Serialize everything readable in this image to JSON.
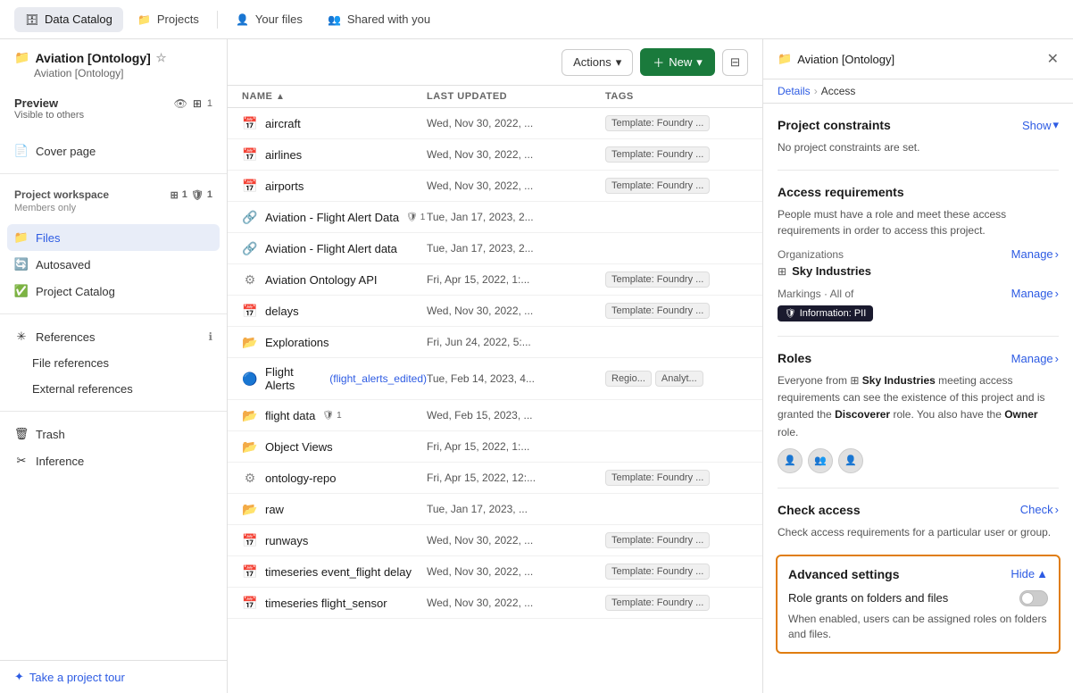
{
  "nav": {
    "tabs": [
      {
        "id": "data-catalog",
        "label": "Data Catalog",
        "icon": "🗄",
        "active": true
      },
      {
        "id": "projects",
        "label": "Projects",
        "icon": "📁",
        "active": false
      },
      {
        "id": "your-files",
        "label": "Your files",
        "icon": "👤",
        "active": false
      },
      {
        "id": "shared-with-you",
        "label": "Shared with you",
        "icon": "👥",
        "active": false
      }
    ]
  },
  "sidebar": {
    "project_title": "Aviation [Ontology]",
    "project_subtitle": "Aviation [Ontology]",
    "preview": {
      "title": "Preview",
      "subtitle": "Visible to others"
    },
    "cover_page": "Cover page",
    "project_workspace": {
      "title": "Project workspace",
      "subtitle": "Members only",
      "count1": "1",
      "count2": "1"
    },
    "files_label": "Files",
    "autosaved_label": "Autosaved",
    "project_catalog_label": "Project Catalog",
    "references_label": "References",
    "file_references_label": "File references",
    "external_references_label": "External references",
    "trash_label": "Trash",
    "inference_label": "Inference",
    "take_tour": "Take a project tour"
  },
  "toolbar": {
    "actions_label": "Actions",
    "new_label": "New",
    "actions_chevron": "▾",
    "new_chevron": "▾"
  },
  "file_table": {
    "columns": [
      "NAME",
      "LAST UPDATED",
      "TAGS"
    ],
    "rows": [
      {
        "name": "aircraft",
        "icon": "📅",
        "updated": "Wed, Nov 30, 2022, ...",
        "tags": [
          "Template: Foundry ..."
        ]
      },
      {
        "name": "airlines",
        "icon": "📅",
        "updated": "Wed, Nov 30, 2022, ...",
        "tags": [
          "Template: Foundry ..."
        ]
      },
      {
        "name": "airports",
        "icon": "📅",
        "updated": "Wed, Nov 30, 2022, ...",
        "tags": [
          "Template: Foundry ..."
        ]
      },
      {
        "name": "Aviation - Flight Alert Data",
        "icon": "🔗",
        "updated": "Tue, Jan 17, 2023, 2...",
        "tags": [],
        "locked": true
      },
      {
        "name": "Aviation - Flight Alert data",
        "icon": "🔗",
        "updated": "Tue, Jan 17, 2023, 2...",
        "tags": []
      },
      {
        "name": "Aviation Ontology API",
        "icon": "⚙",
        "updated": "Fri, Apr 15, 2022, 1:...",
        "tags": [
          "Template: Foundry ..."
        ]
      },
      {
        "name": "delays",
        "icon": "📅",
        "updated": "Wed, Nov 30, 2022, ...",
        "tags": [
          "Template: Foundry ..."
        ]
      },
      {
        "name": "Explorations",
        "icon": "📂",
        "updated": "Fri, Jun 24, 2022, 5:...",
        "tags": [],
        "folder_yellow": true
      },
      {
        "name": "Flight Alerts",
        "nameExtra": "(flight_alerts_edited)",
        "icon": "🔵",
        "updated": "Tue, Feb 14, 2023, 4...",
        "tags": [
          "Regio...",
          "Analyt..."
        ],
        "is_link": true
      },
      {
        "name": "flight data",
        "icon": "📂",
        "updated": "Wed, Feb 15, 2023, ...",
        "tags": [],
        "locked": true,
        "folder_yellow": true
      },
      {
        "name": "Object Views",
        "icon": "📂",
        "updated": "Fri, Apr 15, 2022, 1:...",
        "tags": [],
        "folder_yellow": true
      },
      {
        "name": "ontology-repo",
        "icon": "⚙",
        "updated": "Fri, Apr 15, 2022, 12:...",
        "tags": [
          "Template: Foundry ..."
        ]
      },
      {
        "name": "raw",
        "icon": "📂",
        "updated": "Tue, Jan 17, 2023, ...",
        "tags": [],
        "folder_yellow": true
      },
      {
        "name": "runways",
        "icon": "📅",
        "updated": "Wed, Nov 30, 2022, ...",
        "tags": [
          "Template: Foundry ..."
        ]
      },
      {
        "name": "timeseries event_flight delay",
        "icon": "📅",
        "updated": "Wed, Nov 30, 2022, ...",
        "tags": [
          "Template: Foundry ..."
        ]
      },
      {
        "name": "timeseries flight_sensor",
        "icon": "📅",
        "updated": "Wed, Nov 30, 2022, ...",
        "tags": [
          "Template: Foundry ..."
        ]
      }
    ]
  },
  "right_panel": {
    "title": "Aviation [Ontology]",
    "title_icon": "📁",
    "breadcrumb_details": "Details",
    "breadcrumb_access": "Access",
    "project_constraints": {
      "title": "Project constraints",
      "action": "Show",
      "text": "No project constraints are set."
    },
    "access_requirements": {
      "title": "Access requirements",
      "text": "People must have a role and meet these access requirements in order to access this project.",
      "organizations_label": "Organizations",
      "organizations_action": "Manage",
      "org_name": "Sky Industries",
      "markings_label": "Markings · All of",
      "markings_action": "Manage",
      "marking_badge": "Information: PII"
    },
    "roles": {
      "title": "Roles",
      "action": "Manage",
      "text_part1": "Everyone from",
      "org_name": "Sky Industries",
      "text_part2": "meeting access requirements can see the existence of this project and is granted the",
      "role_discoverer": "Discoverer",
      "text_part3": "role. You also have the",
      "role_owner": "Owner",
      "text_part4": "role."
    },
    "check_access": {
      "title": "Check access",
      "action": "Check",
      "text": "Check access requirements for a particular user or group."
    },
    "advanced_settings": {
      "title": "Advanced settings",
      "action": "Hide",
      "toggle_label": "Role grants on folders and files",
      "toggle_desc": "When enabled, users can be assigned roles on folders and files."
    }
  }
}
